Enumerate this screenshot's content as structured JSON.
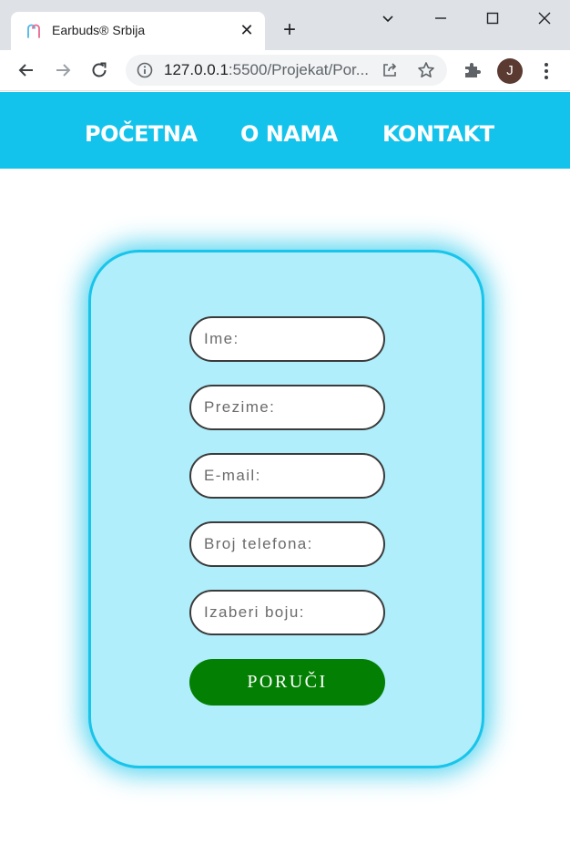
{
  "browser": {
    "tab_title": "Earbuds® Srbija",
    "url_host": "127.0.0.1",
    "url_rest": ":5500/Projekat/Por...",
    "profile_initial": "J"
  },
  "nav": {
    "items": [
      "POČETNA",
      "O NAMA",
      "KONTAKT"
    ]
  },
  "form": {
    "fields": [
      {
        "placeholder": "Ime:"
      },
      {
        "placeholder": "Prezime:"
      },
      {
        "placeholder": "E-mail:"
      },
      {
        "placeholder": "Broj telefona:"
      },
      {
        "placeholder": "Izaberi boju:"
      }
    ],
    "submit_label": "PORUČI"
  },
  "colors": {
    "navbar": "#14c3eb",
    "card_bg": "#b0eefb",
    "card_border": "#18c4ea",
    "button": "#038003"
  }
}
